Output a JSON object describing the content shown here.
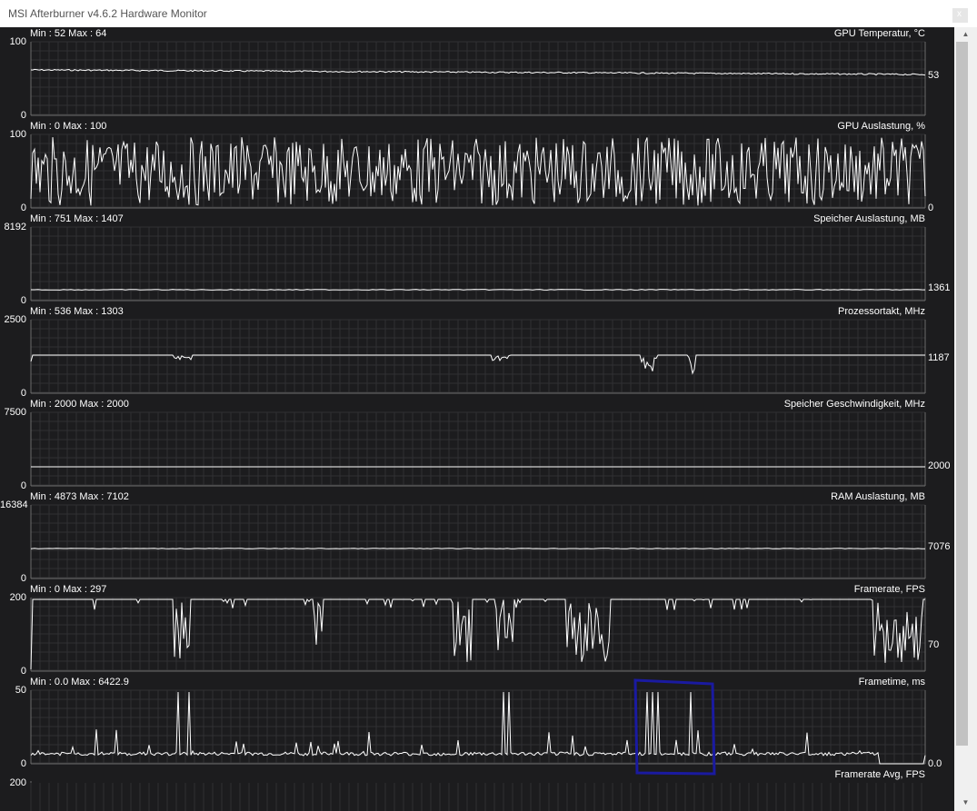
{
  "window": {
    "title": "MSI Afterburner v4.6.2 Hardware Monitor",
    "close_label": "x"
  },
  "graphs": [
    {
      "name": "GPU Temperatur, °C",
      "min_max": "Min : 52   Max : 64",
      "y_top": "100",
      "y_bottom": "0",
      "current": "53"
    },
    {
      "name": "GPU Auslastung, %",
      "min_max": "Min : 0   Max : 100",
      "y_top": "100",
      "y_bottom": "0",
      "current": "0"
    },
    {
      "name": "Speicher Auslastung, MB",
      "min_max": "Min : 751   Max : 1407",
      "y_top": "8192",
      "y_bottom": "0",
      "current": "1361"
    },
    {
      "name": "Prozessortakt, MHz",
      "min_max": "Min : 536   Max : 1303",
      "y_top": "2500",
      "y_bottom": "0",
      "current": "1187"
    },
    {
      "name": "Speicher Geschwindigkeit, MHz",
      "min_max": "Min : 2000   Max : 2000",
      "y_top": "7500",
      "y_bottom": "0",
      "current": "2000"
    },
    {
      "name": "RAM Auslastung, MB",
      "min_max": "Min : 4873   Max : 7102",
      "y_top": "16384",
      "y_bottom": "0",
      "current": "7076"
    },
    {
      "name": "Framerate, FPS",
      "min_max": "Min : 0   Max : 297",
      "y_top": "200",
      "y_bottom": "0",
      "current": "70"
    },
    {
      "name": "Frametime, ms",
      "min_max": "Min : 0.0   Max : 6422.9",
      "y_top": "50",
      "y_bottom": "0",
      "current": "0.0"
    },
    {
      "name": "Framerate Avg, FPS",
      "y_top": "200"
    }
  ],
  "scrollbar": {
    "up_icon": "▲",
    "down_icon": "▼"
  },
  "colors": {
    "background": "#1c1c1e",
    "grid": "#333333",
    "trace": "#ffffff",
    "annotation": "#1a1aa0"
  }
}
